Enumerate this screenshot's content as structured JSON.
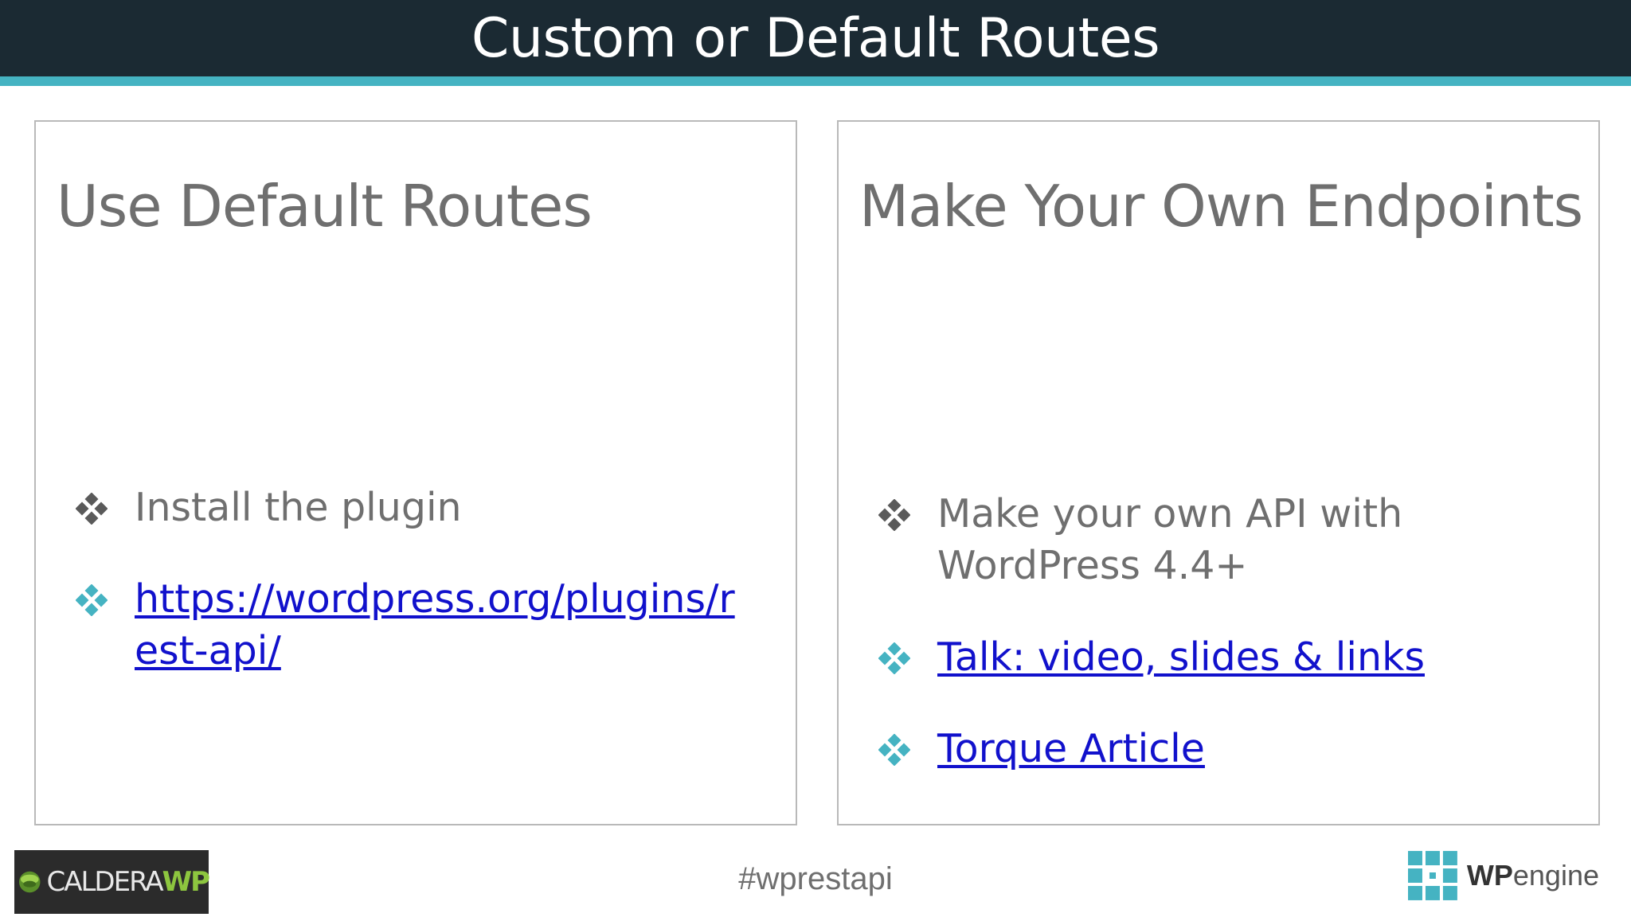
{
  "slide": {
    "title": "Custom or Default Routes"
  },
  "left_panel": {
    "title": "Use Default Routes",
    "items": [
      {
        "text": "Install the plugin",
        "type": "text"
      },
      {
        "text": "https://wordpress.org/plugins/rest-api/",
        "type": "link"
      }
    ]
  },
  "right_panel": {
    "title": "Make Your Own Endpoints",
    "items": [
      {
        "text": "Make your own API with WordPress 4.4+",
        "type": "text"
      },
      {
        "text": "Talk: video, slides & links",
        "type": "link"
      },
      {
        "text": "Torque Article",
        "type": "link"
      }
    ]
  },
  "footer": {
    "hashtag": "#wprestapi",
    "left_logo": {
      "part1": "CALDERA",
      "part2": "WP"
    },
    "right_logo": {
      "part1": "WP",
      "part2": "engine"
    }
  },
  "colors": {
    "header_bg": "#1b2a33",
    "header_accent": "#45b3c2",
    "text_gray": "#6f6f6f",
    "link_blue": "#1111cc",
    "bullet_gray": "#5a5a5a",
    "bullet_teal": "#45b3c2"
  },
  "icons": {
    "bullet": "diamond-bullet-icon"
  }
}
